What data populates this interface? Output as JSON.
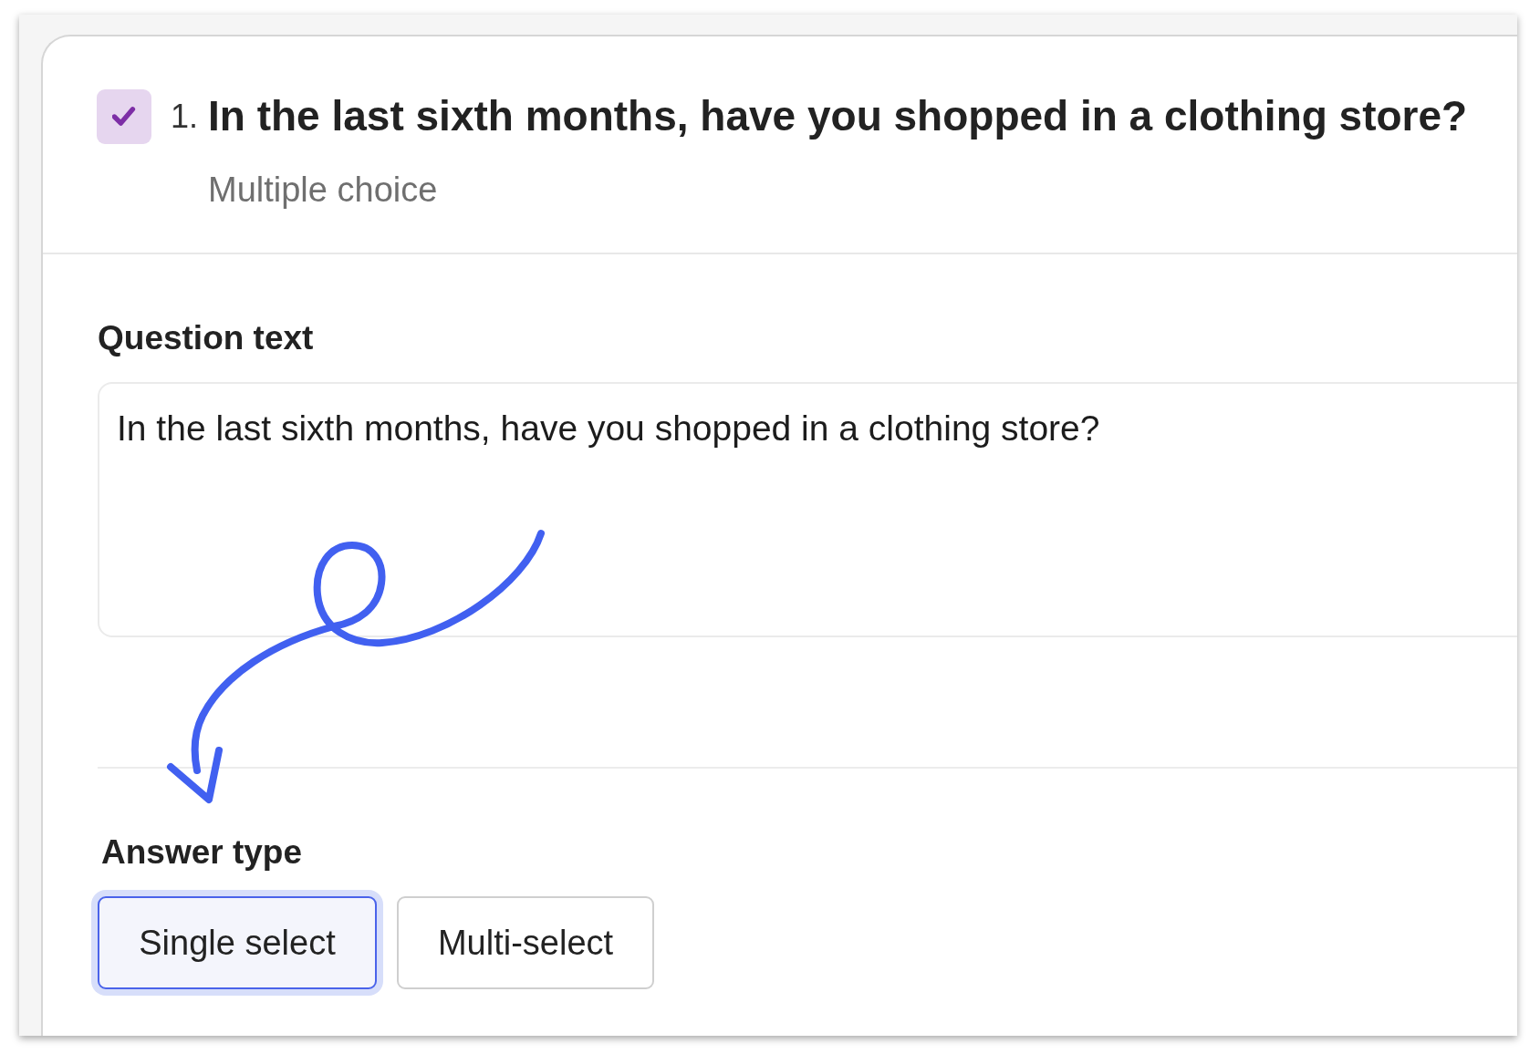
{
  "question": {
    "checked": true,
    "number": "1.",
    "title": "In the last sixth months, have you shopped in a clothing store?",
    "type_label": "Multiple choice"
  },
  "question_text": {
    "label": "Question text",
    "value": "In the last sixth months, have you shopped in a clothing store?"
  },
  "answer_type": {
    "label": "Answer type",
    "options": [
      {
        "label": "Single select",
        "selected": true
      },
      {
        "label": "Multi-select",
        "selected": false
      }
    ]
  }
}
